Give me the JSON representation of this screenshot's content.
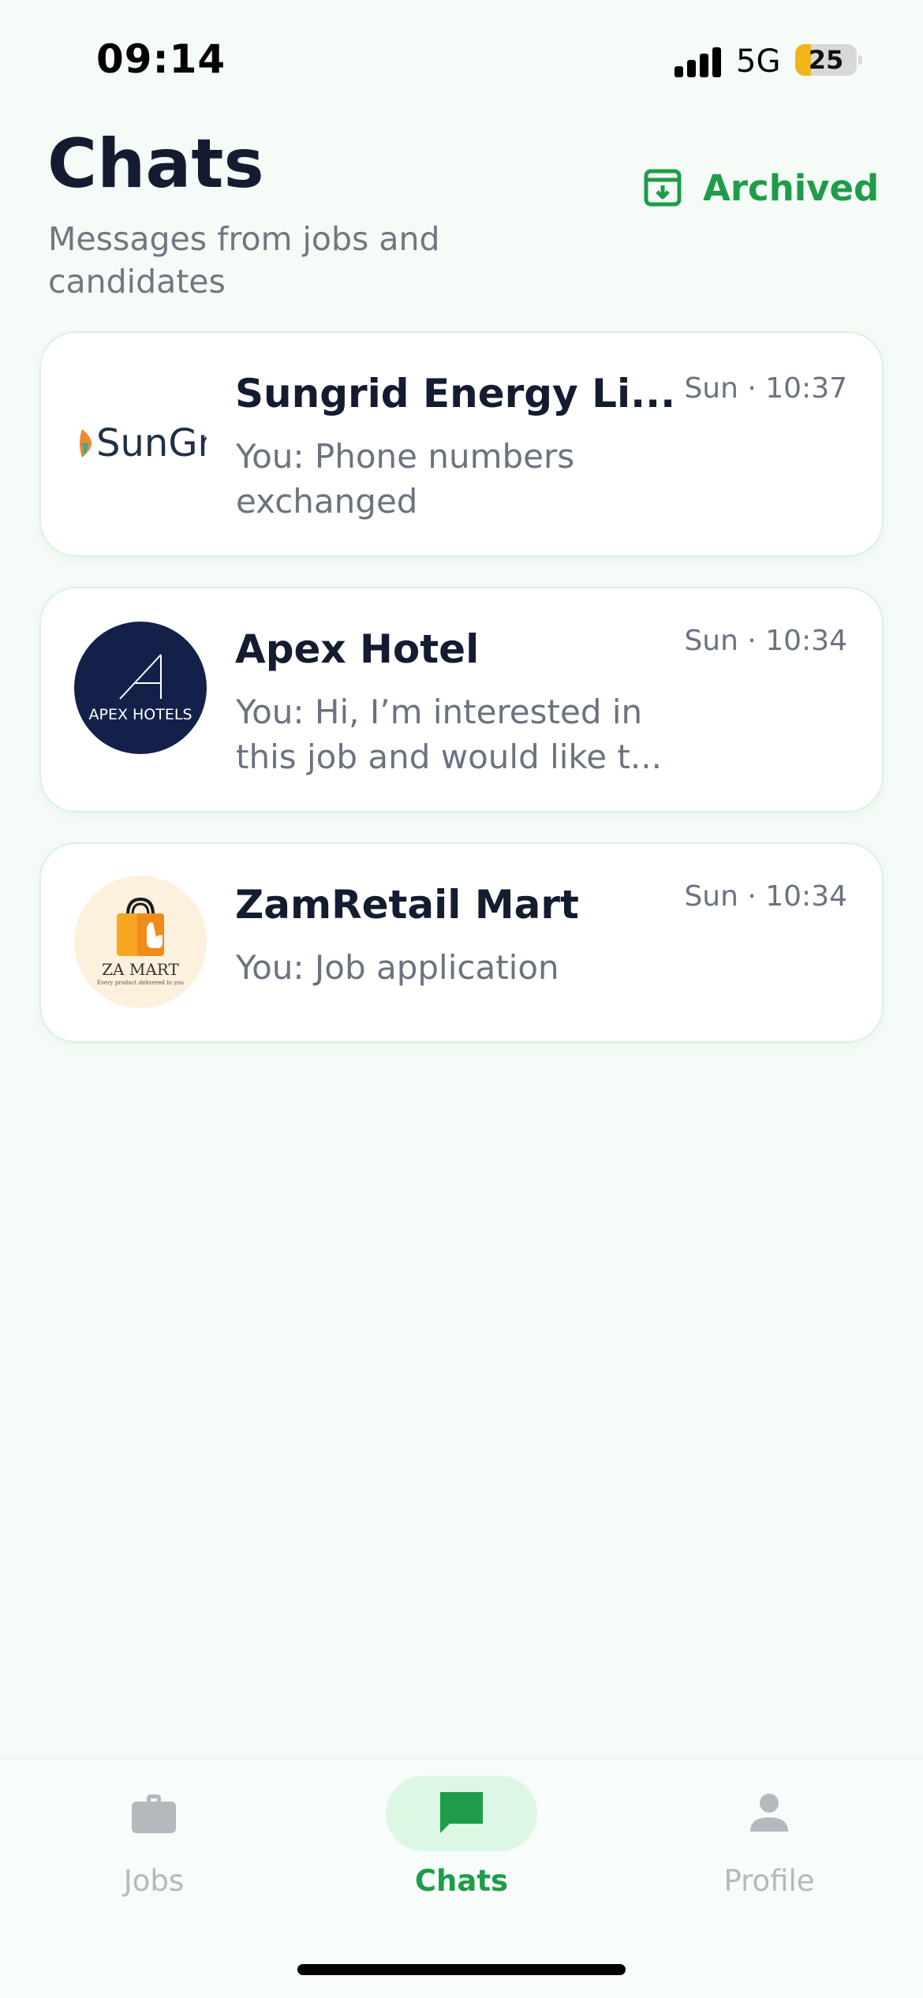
{
  "status_bar": {
    "time": "09:14",
    "network": "5G",
    "battery_level": "25",
    "battery_color": "#f3b51a",
    "signal_icon": "signal-bars-icon"
  },
  "header": {
    "title": "Chats",
    "subtitle": "Messages from jobs and candidates",
    "archived_label": "Archived",
    "archived_icon": "archive-box-icon"
  },
  "chats": [
    {
      "name": "Sungrid Energy Li...",
      "time": "Sun · 10:37",
      "preview": "You: Phone numbers exchanged",
      "logo_text": "SunGr"
    },
    {
      "name": "Apex Hotel",
      "time": "Sun · 10:34",
      "preview": "You: Hi, I’m interested in this job and would like t...",
      "logo_text": "APEX HOTELS"
    },
    {
      "name": "ZamRetail Mart",
      "time": "Sun · 10:34",
      "preview": "You: Job application",
      "logo_text": "ZA MART",
      "logo_tagline": "Every product delivered to you"
    }
  ],
  "nav": {
    "items": [
      {
        "label": "Jobs",
        "icon": "briefcase-icon",
        "active": false
      },
      {
        "label": "Chats",
        "icon": "chat-bubble-icon",
        "active": true
      },
      {
        "label": "Profile",
        "icon": "person-icon",
        "active": false
      }
    ]
  },
  "colors": {
    "accent": "#1f9c49",
    "background": "#f5fbf7",
    "title": "#141c31",
    "muted": "#6b7280"
  }
}
